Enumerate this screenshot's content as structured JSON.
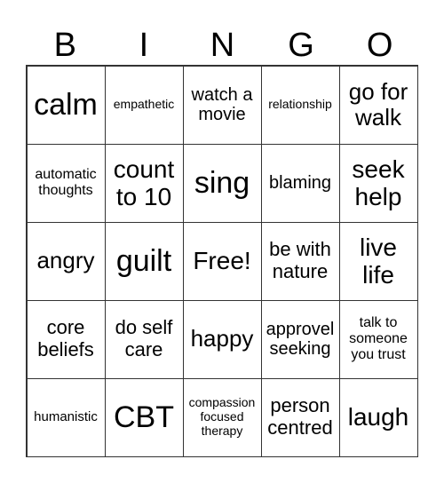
{
  "header": [
    "B",
    "I",
    "N",
    "G",
    "O"
  ],
  "cells": [
    "calm",
    "empathetic",
    "watch a movie",
    "relationship",
    "go for walk",
    "automatic thoughts",
    "count to 10",
    "sing",
    "blaming",
    "seek help",
    "angry",
    "guilt",
    "Free!",
    "be with nature",
    "live life",
    "core beliefs",
    "do self care",
    "happy",
    "approvel seeking",
    "talk to someone you trust",
    "humanistic",
    "CBT",
    "compassion focused therapy",
    "person centred",
    "laugh"
  ]
}
